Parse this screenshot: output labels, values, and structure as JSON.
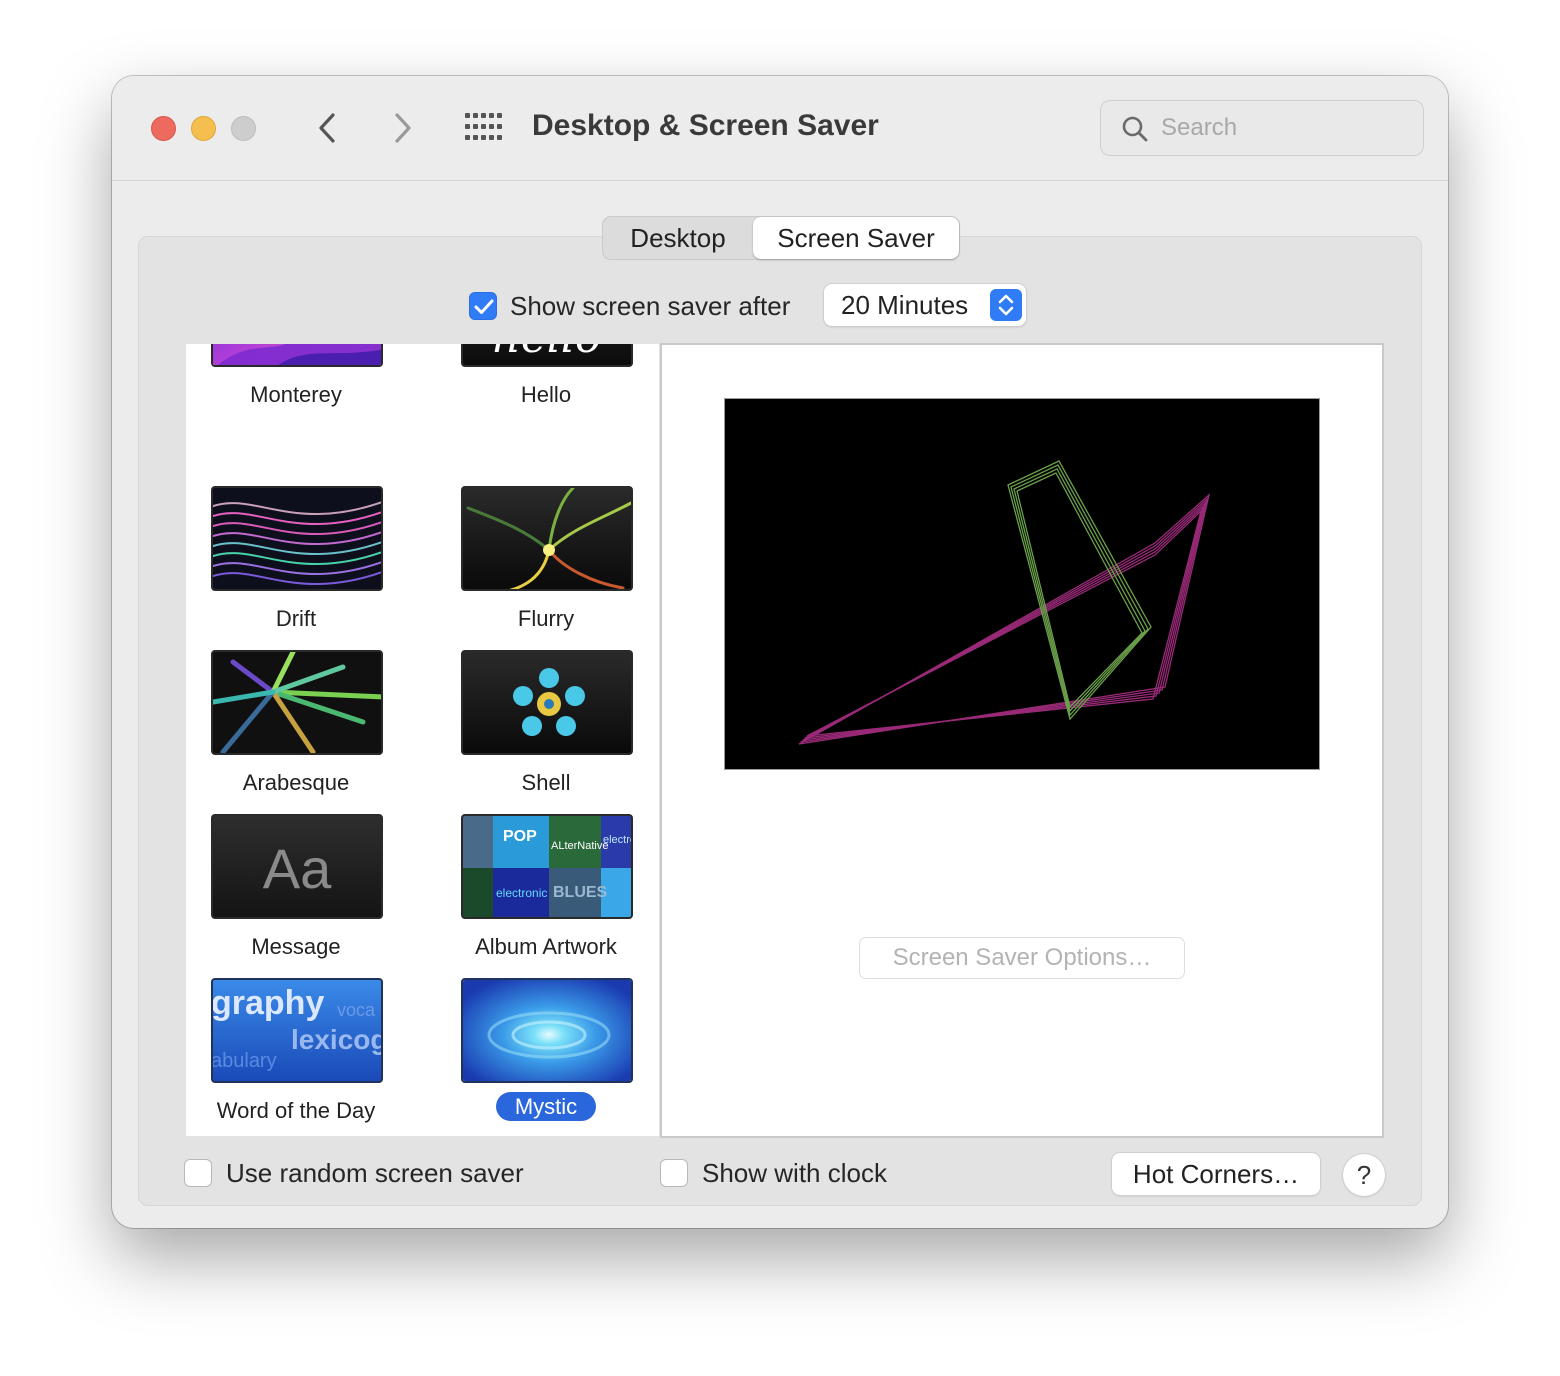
{
  "window": {
    "title": "Desktop & Screen Saver"
  },
  "search": {
    "placeholder": "Search"
  },
  "tabs": {
    "desktop": "Desktop",
    "screen_saver": "Screen Saver",
    "active": "Screen Saver"
  },
  "show_after": {
    "label": "Show screen saver after",
    "checked": true,
    "value": "20 Minutes"
  },
  "savers": [
    {
      "name": "Monterey"
    },
    {
      "name": "Hello",
      "thumb_text": "hello"
    },
    {
      "name": "Drift"
    },
    {
      "name": "Flurry"
    },
    {
      "name": "Arabesque"
    },
    {
      "name": "Shell"
    },
    {
      "name": "Message",
      "thumb_text": "Aa"
    },
    {
      "name": "Album Artwork",
      "thumb_text": [
        "POP",
        "ALterNative",
        "electro",
        "electronic",
        "BLUES"
      ]
    },
    {
      "name": "Word of the Day",
      "thumb_text": [
        "graphy",
        "voca",
        "lexicog",
        "abulary"
      ]
    },
    {
      "name": "Mystic",
      "selected": true
    }
  ],
  "preview": {
    "options_button": "Screen Saver Options…"
  },
  "bottom": {
    "random": {
      "label": "Use random screen saver",
      "checked": false
    },
    "clock": {
      "label": "Show with clock",
      "checked": false
    },
    "hot_corners": "Hot Corners…",
    "help": "?"
  },
  "colors": {
    "accent": "#2f7cf6",
    "selection": "#2a66dc"
  }
}
